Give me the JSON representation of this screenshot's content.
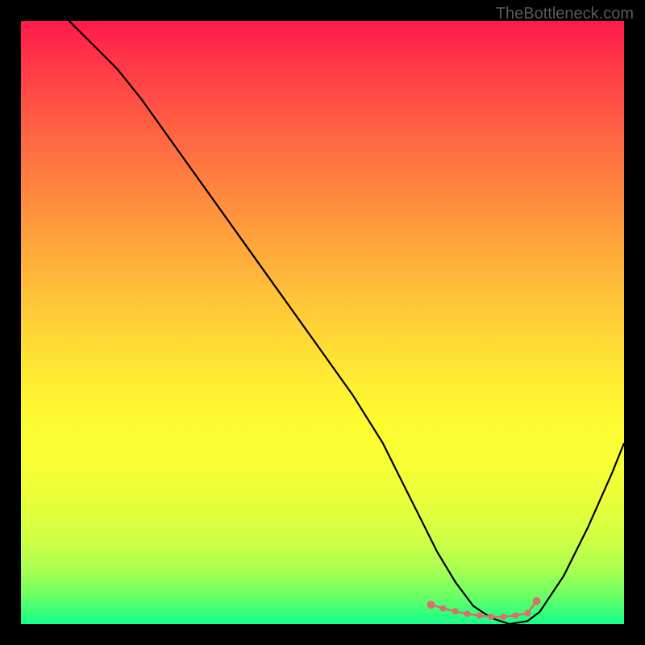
{
  "watermark": "TheBottleneck.com",
  "chart_data": {
    "type": "line",
    "title": "",
    "xlabel": "",
    "ylabel": "",
    "xlim": [
      0,
      100
    ],
    "ylim": [
      0,
      100
    ],
    "series": [
      {
        "name": "bottleneck-curve",
        "x": [
          8,
          12,
          16,
          20,
          25,
          30,
          35,
          40,
          45,
          50,
          55,
          60,
          63,
          66,
          69,
          72,
          75,
          78,
          81,
          84,
          86,
          90,
          94,
          98,
          100
        ],
        "y": [
          100,
          96,
          92,
          87,
          80,
          73,
          66,
          59,
          52,
          45,
          38,
          30,
          24,
          18,
          12,
          7,
          3,
          1,
          0,
          0.5,
          2,
          8,
          16,
          25,
          30
        ]
      }
    ],
    "markers": {
      "name": "optimal-range",
      "x": [
        68,
        70,
        72,
        74,
        76,
        78,
        80,
        82,
        84,
        85.5
      ],
      "y": [
        3.2,
        2.6,
        2.1,
        1.7,
        1.4,
        1.2,
        1.2,
        1.4,
        1.8,
        3.8
      ]
    },
    "gradient": {
      "top_color": "#ff1a4a",
      "mid_color": "#fff830",
      "bottom_color": "#14ff8a"
    }
  }
}
